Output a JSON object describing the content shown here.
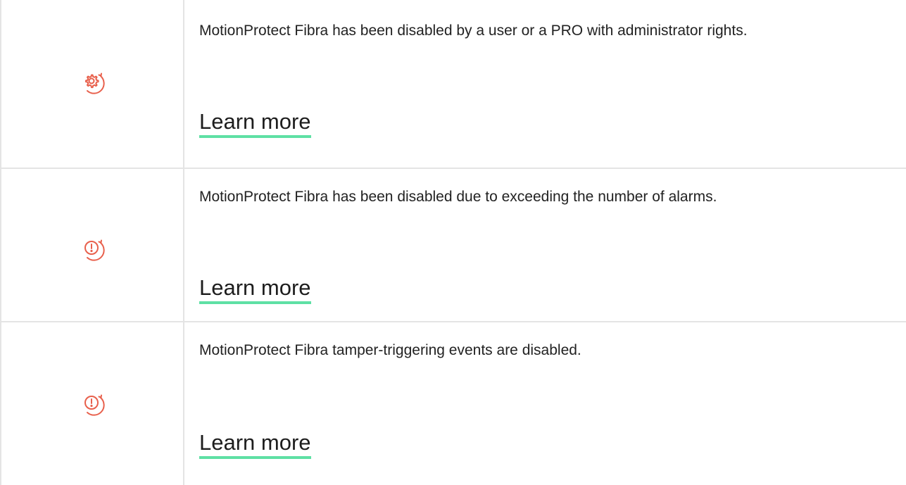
{
  "rows": [
    {
      "icon": "gear-refresh-icon",
      "description": "MotionProtect Fibra has been disabled by a user or a PRO with administrator rights.",
      "link_label": "Learn more"
    },
    {
      "icon": "alert-refresh-icon",
      "description": "MotionProtect Fibra has been disabled due to exceeding the number of alarms.",
      "link_label": "Learn more"
    },
    {
      "icon": "alert-refresh-icon",
      "description": "MotionProtect Fibra tamper-triggering events are disabled.",
      "link_label": "Learn more"
    }
  ],
  "colors": {
    "icon": "#e8604c",
    "link_underline": "#5ee0a4",
    "border": "#e4e4e4",
    "text": "#222222"
  }
}
